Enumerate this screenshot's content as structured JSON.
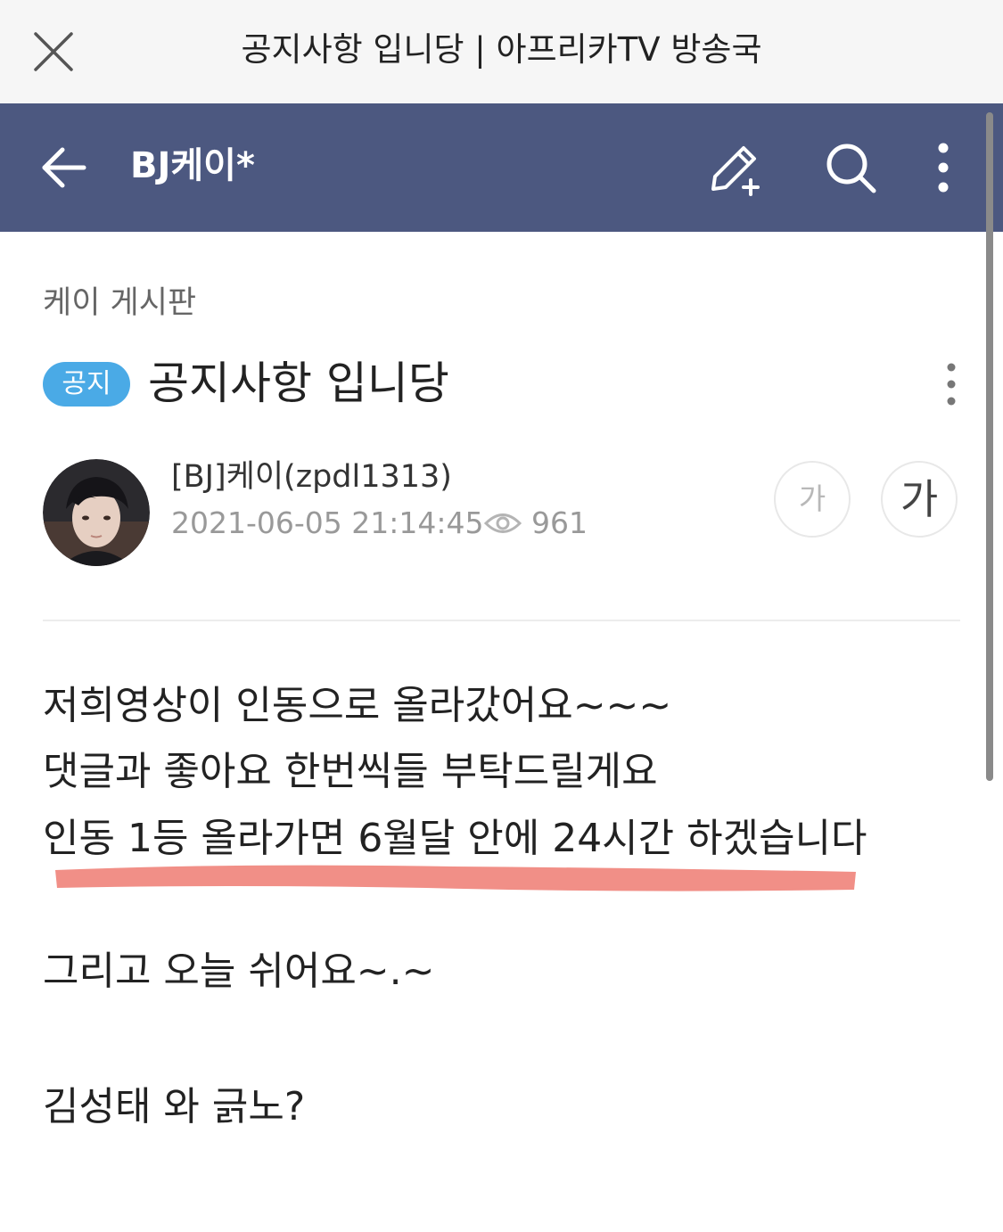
{
  "webview": {
    "title": "공지사항 입니당 | 아프리카TV 방송국"
  },
  "appbar": {
    "title": "BJ케이*",
    "background": "#4c5880",
    "icons": [
      "back-arrow-icon",
      "write-icon",
      "search-icon",
      "more-vertical-icon"
    ]
  },
  "post": {
    "board": "케이 게시판",
    "badge": "공지",
    "badge_color": "#4aaae6",
    "title": "공지사항 입니당",
    "author": "[BJ]케이(zpdl1313)",
    "date": "2021-06-05 21:14:45",
    "views": "961",
    "font_small_label": "가",
    "font_large_label": "가",
    "body": [
      "저희영상이 인동으로 올라갔어요~~~",
      "댓글과 좋아요 한번씩들 부탁드릴게요",
      "인동 1등 올라가면 6월달 안에 24시간 하겠습니다",
      "그리고 오늘 쉬어요~.~",
      "김성태 와 긁노?"
    ],
    "highlight_color": "#ef7b72"
  }
}
